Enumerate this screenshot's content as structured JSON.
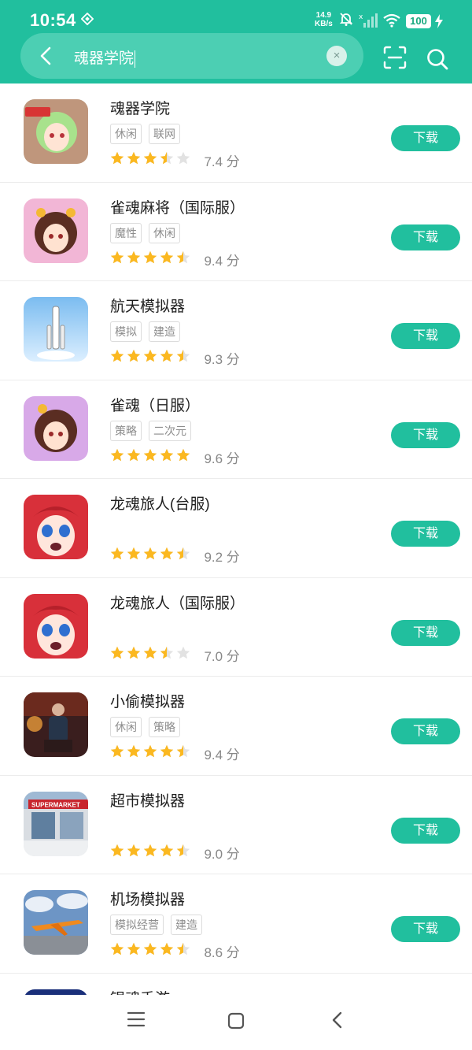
{
  "status_bar": {
    "time": "10:54",
    "net_speed_value": "14.9",
    "net_speed_unit": "KB/s",
    "battery": "100",
    "icons": [
      "diamond-icon",
      "bell-off-icon",
      "signal-icon",
      "wifi-icon",
      "charging-icon"
    ]
  },
  "search": {
    "query": "魂器学院",
    "clear_symbol": "×"
  },
  "colors": {
    "accent": "#21bf9e",
    "star": "#fbb820",
    "star_empty": "#e2e2e2"
  },
  "apps": [
    {
      "name": "魂器学院",
      "tags": [
        "休闲",
        "联网"
      ],
      "stars": 3.5,
      "score": "7.4 分",
      "button": "下载",
      "icon": "anime-girl-green-hair"
    },
    {
      "name": "雀魂麻将（国际服）",
      "tags": [
        "魔性",
        "休闲"
      ],
      "stars": 4.5,
      "score": "9.4 分",
      "button": "下载",
      "icon": "anime-girl-cat-ears"
    },
    {
      "name": "航天模拟器",
      "tags": [
        "模拟",
        "建造"
      ],
      "stars": 4.5,
      "score": "9.3 分",
      "button": "下载",
      "icon": "rocket"
    },
    {
      "name": "雀魂（日服）",
      "tags": [
        "策略",
        "二次元"
      ],
      "stars": 5,
      "score": "9.6 分",
      "button": "下载",
      "icon": "anime-girl-cat-ears"
    },
    {
      "name": "龙魂旅人(台服)",
      "tags": [],
      "stars": 4.5,
      "score": "9.2 分",
      "button": "下载",
      "icon": "red-hair-girl"
    },
    {
      "name": "龙魂旅人（国际服）",
      "tags": [],
      "stars": 3.5,
      "score": "7.0 分",
      "button": "下载",
      "icon": "red-hair-girl"
    },
    {
      "name": "小偷模拟器",
      "tags": [
        "休闲",
        "策略"
      ],
      "stars": 4.5,
      "score": "9.4 分",
      "button": "下载",
      "icon": "thief-man"
    },
    {
      "name": "超市模拟器",
      "tags": [],
      "stars": 4.5,
      "score": "9.0 分",
      "button": "下载",
      "icon": "supermarket",
      "icon_text": "SUPERMARKET"
    },
    {
      "name": "机场模拟器",
      "tags": [
        "模拟经营",
        "建造"
      ],
      "stars": 4.5,
      "score": "8.6 分",
      "button": "下载",
      "icon": "airplane"
    },
    {
      "name": "银魂手游",
      "tags": [],
      "stars": null,
      "score": null,
      "button": null,
      "icon": "ginzan-logo"
    }
  ],
  "nav": {
    "icons": [
      "menu-icon",
      "home-icon",
      "back-icon"
    ]
  }
}
